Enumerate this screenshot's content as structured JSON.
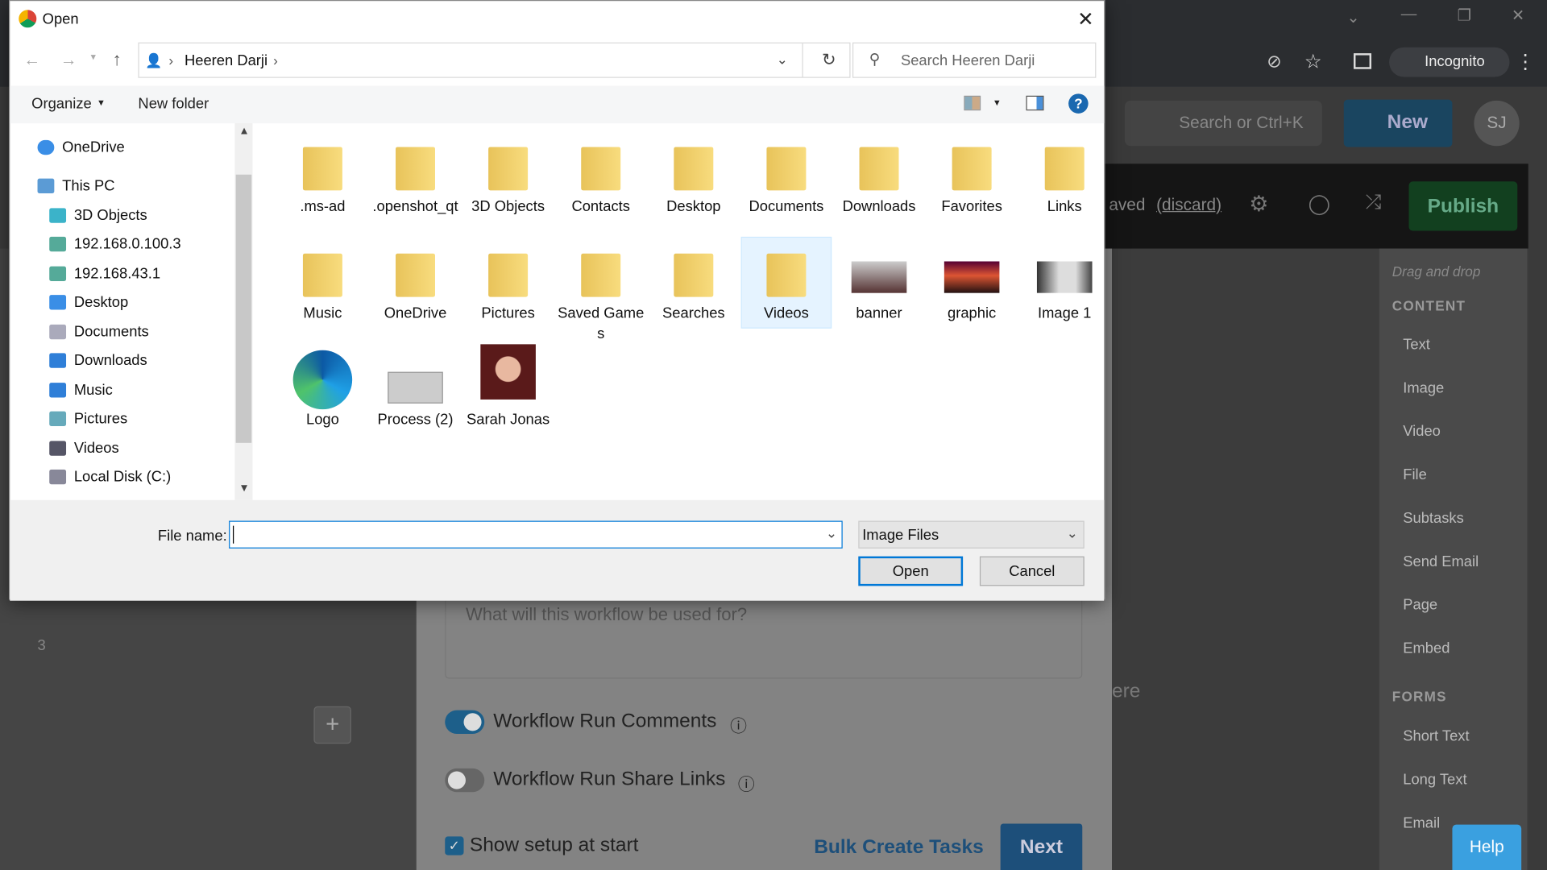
{
  "browser": {
    "incognito_label": "Incognito"
  },
  "app": {
    "search_placeholder": "Search or Ctrl+K",
    "new_button": "New",
    "avatar": "SJ",
    "saved_text": "aved",
    "discard_link": "(discard)",
    "publish_button": "Publish",
    "drag_hint": "Drag and drop",
    "content_heading": "CONTENT",
    "content_items": [
      "Text",
      "Image",
      "Video",
      "File",
      "Subtasks",
      "Send Email",
      "Page",
      "Embed"
    ],
    "forms_heading": "FORMS",
    "forms_items": [
      "Short Text",
      "Long Text",
      "Email"
    ],
    "row_number": "3",
    "textarea_placeholder": "What will this workflow be used for?",
    "partial_text": "ere",
    "toggle_comments_label": "Workflow Run Comments",
    "toggle_comments_on": true,
    "toggle_share_label": "Workflow Run Share Links",
    "toggle_share_on": false,
    "show_setup_label": "Show setup at start",
    "bulk_create_button": "Bulk Create Tasks",
    "next_button": "Next",
    "help_button": "Help",
    "add_button": "+"
  },
  "dialog": {
    "title": "Open",
    "breadcrumb": [
      "Heeren Darji"
    ],
    "search_placeholder": "Search Heeren Darji",
    "organize": "Organize",
    "new_folder": "New folder",
    "nav_items": [
      "OneDrive",
      "This PC",
      "3D Objects",
      "192.168.0.100.3",
      "192.168.43.1",
      "Desktop",
      "Documents",
      "Downloads",
      "Music",
      "Pictures",
      "Videos",
      "Local Disk (C:)"
    ],
    "files": [
      ".ms-ad",
      ".openshot_qt",
      "3D Objects",
      "Contacts",
      "Desktop",
      "Documents",
      "Downloads",
      "Favorites",
      "Links",
      "Music",
      "OneDrive",
      "Pictures",
      "Saved Games",
      "Searches",
      "Videos",
      "banner",
      "graphic",
      "Image 1",
      "Logo",
      "Process (2)",
      "Sarah Jonas"
    ],
    "selected_file": "Videos",
    "file_name_label": "File name:",
    "file_name_value": "",
    "file_type": "Image Files",
    "open_button": "Open",
    "cancel_button": "Cancel"
  },
  "colors": {
    "accent": "#0078d7",
    "publish": "#1a7a3c",
    "next": "#1d6fa5",
    "help": "#3aa0e0"
  }
}
